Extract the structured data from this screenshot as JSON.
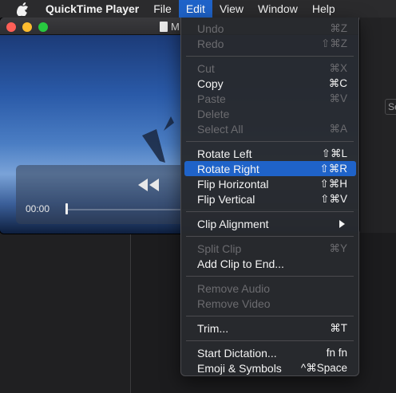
{
  "menubar": {
    "app_name": "QuickTime Player",
    "items": [
      "File",
      "Edit",
      "View",
      "Window",
      "Help"
    ],
    "active_item": "Edit"
  },
  "player": {
    "title": "M",
    "time_elapsed": "00:00"
  },
  "background": {
    "right_label": "Se"
  },
  "edit_menu": {
    "items": [
      {
        "label": "Undo",
        "shortcut": "⌘Z",
        "enabled": false
      },
      {
        "label": "Redo",
        "shortcut": "⇧⌘Z",
        "enabled": false
      },
      {
        "label": "Cut",
        "shortcut": "⌘X",
        "enabled": false
      },
      {
        "label": "Copy",
        "shortcut": "⌘C",
        "enabled": true
      },
      {
        "label": "Paste",
        "shortcut": "⌘V",
        "enabled": false
      },
      {
        "label": "Delete",
        "shortcut": "",
        "enabled": false
      },
      {
        "label": "Select All",
        "shortcut": "⌘A",
        "enabled": false
      },
      {
        "label": "Rotate Left",
        "shortcut": "⇧⌘L",
        "enabled": true
      },
      {
        "label": "Rotate Right",
        "shortcut": "⇧⌘R",
        "enabled": true,
        "highlighted": true
      },
      {
        "label": "Flip Horizontal",
        "shortcut": "⇧⌘H",
        "enabled": true
      },
      {
        "label": "Flip Vertical",
        "shortcut": "⇧⌘V",
        "enabled": true
      },
      {
        "label": "Clip Alignment",
        "shortcut": "",
        "enabled": true,
        "submenu": true
      },
      {
        "label": "Split Clip",
        "shortcut": "⌘Y",
        "enabled": false
      },
      {
        "label": "Add Clip to End...",
        "shortcut": "",
        "enabled": true
      },
      {
        "label": "Remove Audio",
        "shortcut": "",
        "enabled": false
      },
      {
        "label": "Remove Video",
        "shortcut": "",
        "enabled": false
      },
      {
        "label": "Trim...",
        "shortcut": "⌘T",
        "enabled": true
      },
      {
        "label": "Start Dictation...",
        "shortcut": "fn fn",
        "enabled": true
      },
      {
        "label": "Emoji & Symbols",
        "shortcut": "^⌘Space",
        "enabled": true
      }
    ]
  },
  "colors": {
    "highlight": "#1f63c9",
    "menu_bg": "#2a2c30",
    "disabled_text": "#6b6b6f"
  }
}
